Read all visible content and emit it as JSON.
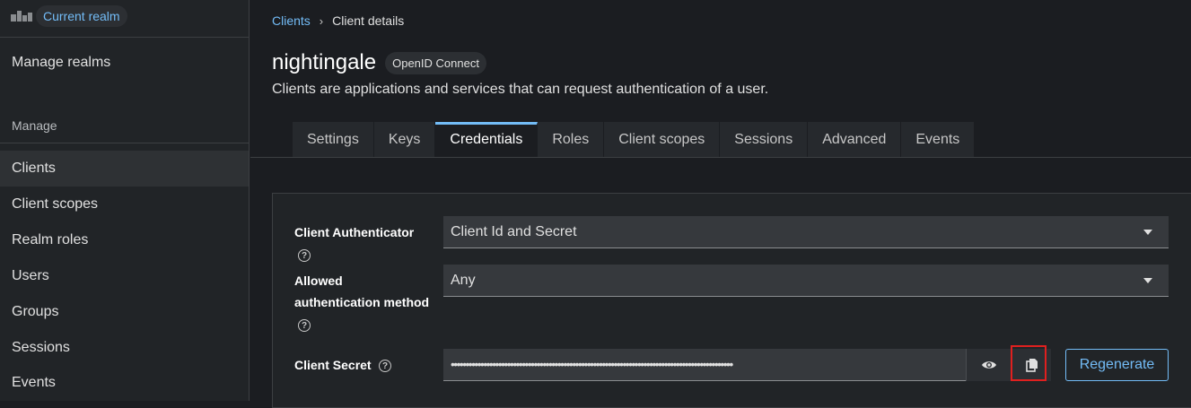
{
  "sidebar": {
    "realm_label": "Current realm",
    "manage_realms": "Manage realms",
    "section_manage": "Manage",
    "items": [
      {
        "label": "Clients",
        "active": true
      },
      {
        "label": "Client scopes"
      },
      {
        "label": "Realm roles"
      },
      {
        "label": "Users"
      },
      {
        "label": "Groups"
      },
      {
        "label": "Sessions"
      },
      {
        "label": "Events"
      }
    ]
  },
  "breadcrumb": {
    "parent": "Clients",
    "separator": "›",
    "current": "Client details"
  },
  "header": {
    "title": "nightingale",
    "protocol_badge": "OpenID Connect",
    "description": "Clients are applications and services that can request authentication of a user."
  },
  "tabs": [
    {
      "label": "Settings"
    },
    {
      "label": "Keys"
    },
    {
      "label": "Credentials",
      "active": true
    },
    {
      "label": "Roles"
    },
    {
      "label": "Client scopes"
    },
    {
      "label": "Sessions"
    },
    {
      "label": "Advanced"
    },
    {
      "label": "Events"
    }
  ],
  "credentials": {
    "client_authenticator_label": "Client Authenticator",
    "client_authenticator_value": "Client Id and Secret",
    "allowed_method_label_line1": "Allowed",
    "allowed_method_label_line2": "authentication method",
    "allowed_method_value": "Any",
    "client_secret_label": "Client Secret",
    "client_secret_value": "•••••••••••••••••••••••••••••••••••••••••••••••••••••••••••••••••••••••••••••••••••••••••••••••",
    "help_glyph": "?",
    "regenerate_label": "Regenerate"
  },
  "icons": {
    "show_secret": "eye-icon",
    "copy": "copy-icon",
    "help": "help-icon",
    "dropdown": "caret-down-icon"
  },
  "colors": {
    "accent": "#73bcf7",
    "highlight": "#e0201f",
    "background": "#1b1d21"
  }
}
